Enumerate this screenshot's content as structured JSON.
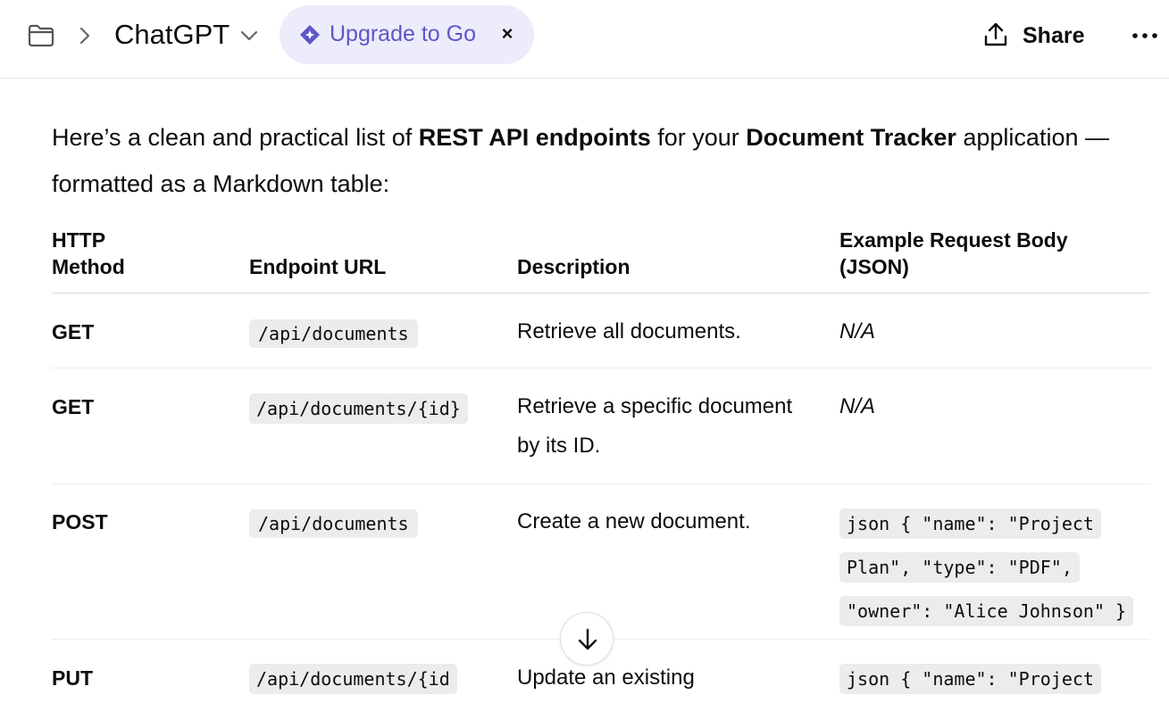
{
  "header": {
    "title": "ChatGPT",
    "upgrade_label": "Upgrade to Go",
    "upgrade_close": "×",
    "share_label": "Share"
  },
  "message": {
    "intro_prefix": "Here’s a clean and practical list of ",
    "intro_bold1": "REST API endpoints",
    "intro_mid": " for your ",
    "intro_bold2": "Document Tracker",
    "intro_suffix": " application — formatted as a Markdown table:"
  },
  "table": {
    "headers": {
      "method_line1": "HTTP",
      "method_line2": "Method",
      "endpoint": "Endpoint URL",
      "description": "Description",
      "body_line1": "Example Request Body",
      "body_line2": "(JSON)"
    },
    "rows": [
      {
        "method": "GET",
        "endpoint": "/api/documents",
        "description": "Retrieve all documents.",
        "body": "N/A"
      },
      {
        "method": "GET",
        "endpoint": "/api/documents/{id}",
        "description": "Retrieve a specific document by its ID.",
        "body": "N/A"
      },
      {
        "method": "POST",
        "endpoint": "/api/documents",
        "description": "Create a new document.",
        "body": "json { \"name\": \"Project Plan\", \"type\": \"PDF\", \"owner\": \"Alice Johnson\" }"
      },
      {
        "method": "PUT",
        "endpoint": "/api/documents/{id",
        "description": "Update an existing",
        "body": "json { \"name\": \"Project"
      }
    ]
  },
  "colors": {
    "accent": "#5e57c8",
    "pill_bg": "#ececfb",
    "code_bg": "#ececec"
  }
}
